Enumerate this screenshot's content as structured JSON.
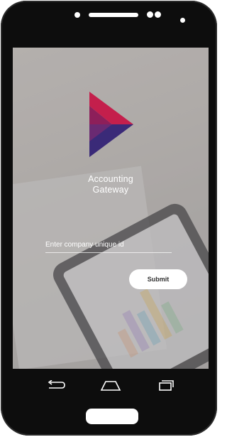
{
  "app": {
    "title_line1": "Accounting",
    "title_line2": "Gateway"
  },
  "form": {
    "company_id_placeholder": "Enter company unique id",
    "submit_label": "Submit"
  },
  "nav_icons": [
    "back-icon",
    "home-icon",
    "recent-apps-icon"
  ],
  "colors": {
    "logo_top": "#c41f4c",
    "logo_mid": "#7a1f63",
    "logo_bottom": "#3a2a78",
    "button_bg": "#ffffff"
  }
}
